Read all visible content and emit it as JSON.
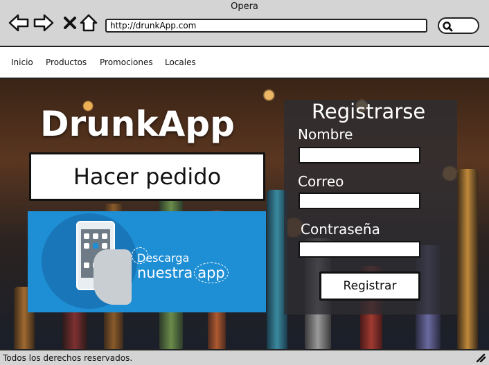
{
  "window": {
    "title": "Opera"
  },
  "browser": {
    "url": "http://drunkApp.com",
    "icons": [
      "back-arrow-icon",
      "forward-arrow-icon",
      "close-icon",
      "home-icon",
      "search-icon"
    ]
  },
  "menu": {
    "items": [
      {
        "label": "Inicio"
      },
      {
        "label": "Productos"
      },
      {
        "label": "Promociones"
      },
      {
        "label": "Locales"
      }
    ]
  },
  "hero": {
    "brand": "DrunkApp",
    "order_button": "Hacer pedido",
    "app_banner": {
      "line1": "Descarga",
      "line2_prefix": "nuestra",
      "line2_app": "app",
      "background": "#1e8fd5"
    }
  },
  "register": {
    "title": "Registrarse",
    "fields": [
      {
        "label": "Nombre",
        "value": ""
      },
      {
        "label": "Correo",
        "value": ""
      },
      {
        "label": "Contraseña",
        "value": ""
      }
    ],
    "submit": "Registrar"
  },
  "footer": {
    "text": "Todos los derechos reservados."
  }
}
